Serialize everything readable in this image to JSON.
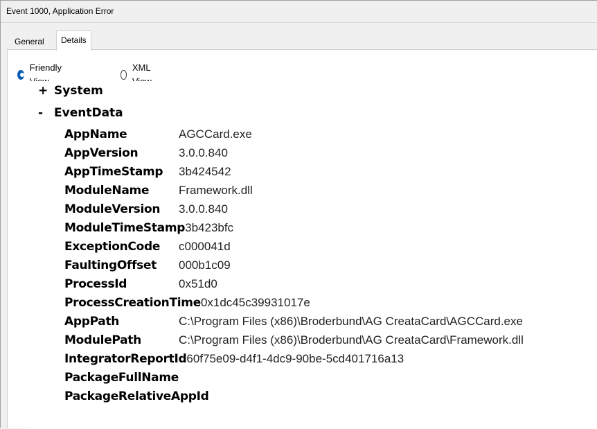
{
  "window": {
    "title": "Event 1000, Application Error"
  },
  "tabs": [
    {
      "label": "General",
      "active": false
    },
    {
      "label": "Details",
      "active": true
    }
  ],
  "view_mode": {
    "friendly_label": "Friendly View",
    "xml_label": "XML View",
    "selected": "Friendly View"
  },
  "tree": {
    "system": {
      "toggle": "+",
      "label": "System"
    },
    "eventdata": {
      "toggle": "-",
      "label": "EventData"
    },
    "fields": [
      {
        "name": "AppName",
        "value": "AGCCard.exe"
      },
      {
        "name": "AppVersion",
        "value": "3.0.0.840"
      },
      {
        "name": "AppTimeStamp",
        "value": "3b424542"
      },
      {
        "name": "ModuleName",
        "value": "Framework.dll"
      },
      {
        "name": "ModuleVersion",
        "value": "3.0.0.840"
      },
      {
        "name": "ModuleTimeStamp",
        "value": "3b423bfc"
      },
      {
        "name": "ExceptionCode",
        "value": "c000041d"
      },
      {
        "name": "FaultingOffset",
        "value": "000b1c09"
      },
      {
        "name": "ProcessId",
        "value": "0x51d0"
      },
      {
        "name": "ProcessCreationTime",
        "value": "0x1dc45c39931017e"
      },
      {
        "name": "AppPath",
        "value": "C:\\Program Files (x86)\\Broderbund\\AG CreataCard\\AGCCard.exe"
      },
      {
        "name": "ModulePath",
        "value": "C:\\Program Files (x86)\\Broderbund\\AG CreataCard\\Framework.dll"
      },
      {
        "name": "IntegratorReportId",
        "value": "60f75e09-d4f1-4dc9-90be-5cd401716a13"
      },
      {
        "name": "PackageFullName",
        "value": ""
      },
      {
        "name": "PackageRelativeAppId",
        "value": ""
      }
    ]
  },
  "colors": {
    "radio_selected": "#0a5fb4",
    "window_bg": "#f0f0f0",
    "panel_bg": "#ffffff"
  }
}
